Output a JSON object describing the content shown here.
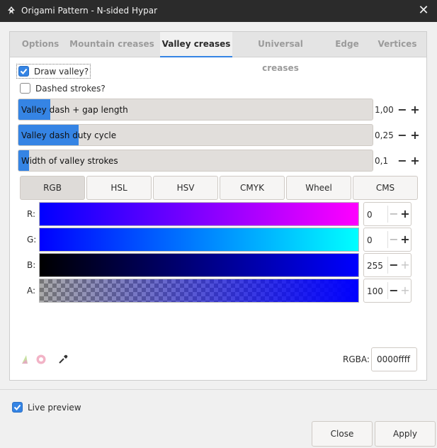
{
  "window": {
    "title": "Origami Pattern - N-sided Hypar",
    "close_glyph": "✕"
  },
  "tabs": [
    {
      "label": "Options"
    },
    {
      "label": "Mountain creases"
    },
    {
      "label": "Valley creases"
    },
    {
      "label": "Universal creases"
    },
    {
      "label": "Edge"
    },
    {
      "label": "Vertices"
    }
  ],
  "active_tab": "Valley creases",
  "checkboxes": {
    "draw_valley": {
      "label": "Draw valley?",
      "checked": true
    },
    "dashed_strokes": {
      "label": "Dashed strokes?",
      "checked": false
    }
  },
  "scales": [
    {
      "label": "Valley dash + gap length",
      "value": "1,00",
      "level": 0.09
    },
    {
      "label": "Valley dash duty cycle",
      "value": "0,25",
      "level": 0.17
    },
    {
      "label": "Width of valley strokes",
      "value": "0,1",
      "level": 0.03
    }
  ],
  "color_modes": [
    "RGB",
    "HSL",
    "HSV",
    "CMYK",
    "Wheel",
    "CMS"
  ],
  "active_color_mode": "RGB",
  "channels": [
    {
      "label": "R:",
      "value": "0"
    },
    {
      "label": "G:",
      "value": "0"
    },
    {
      "label": "B:",
      "value": "255"
    },
    {
      "label": "A:",
      "value": "100"
    }
  ],
  "rgba": {
    "label": "RGBA:",
    "value": "0000ffff"
  },
  "live_preview": {
    "label": "Live preview",
    "checked": true
  },
  "buttons": {
    "close": "Close",
    "apply": "Apply"
  },
  "colors": {
    "accent": "#3584e4",
    "current": "#0000ff"
  }
}
